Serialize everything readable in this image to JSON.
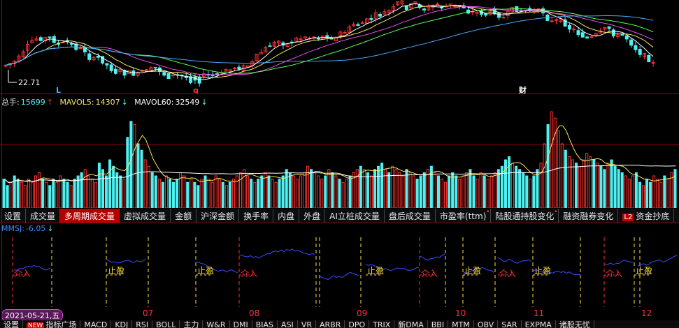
{
  "kline": {
    "low_label": "22.71",
    "markers": [
      {
        "text": "L",
        "color": "#3fa9ff"
      },
      {
        "text": "q",
        "color": "#ff3333"
      },
      {
        "text": "财",
        "color": "#ffffff"
      }
    ]
  },
  "volume_legend": {
    "total_label": "总手:",
    "total_value": "15699",
    "total_arrow": "↑",
    "mavol5_label": "MAVOL5:",
    "mavol5_value": "14307",
    "mavol5_arrow": "↓",
    "mavol60_label": "MAVOL60:",
    "mavol60_value": "32549",
    "mavol60_arrow": "↓"
  },
  "tabs": [
    {
      "label": "设置"
    },
    {
      "label": "成交量"
    },
    {
      "label": "多周期成交量",
      "active": true
    },
    {
      "label": "虚拟成交量"
    },
    {
      "label": "金额"
    },
    {
      "label": "沪深金额"
    },
    {
      "label": "换手率"
    },
    {
      "label": "内盘"
    },
    {
      "label": "外盘"
    },
    {
      "label": "AI立桩成交量"
    },
    {
      "label": "盘后成交量"
    },
    {
      "label": "市盈率(ttm)",
      "dot": "•"
    },
    {
      "label": "陆股通持股变化",
      "dot": "•"
    },
    {
      "label": "融资融券变化"
    },
    {
      "label": "资金抄底",
      "badge": "L2"
    }
  ],
  "indicator": {
    "label": "MMSJ:",
    "value": "-6.05",
    "arrow": "↓",
    "buy_text": "介入",
    "sell_text": "止盈"
  },
  "xaxis": {
    "date_box": "2021-05-21,五",
    "months": [
      "07",
      "08",
      "09",
      "10",
      "11",
      "12"
    ]
  },
  "bottom_tabs": [
    {
      "label": "设置"
    },
    {
      "label": "指标广场",
      "new": "NEW"
    },
    {
      "label": "MACD"
    },
    {
      "label": "KDJ"
    },
    {
      "label": "RSI"
    },
    {
      "label": "BOLL"
    },
    {
      "label": "主力"
    },
    {
      "label": "W&R"
    },
    {
      "label": "DMI"
    },
    {
      "label": "BIAS"
    },
    {
      "label": "ASI"
    },
    {
      "label": "VR"
    },
    {
      "label": "ARBR"
    },
    {
      "label": "DPO"
    },
    {
      "label": "TRIX"
    },
    {
      "label": "新DMA"
    },
    {
      "label": "BBI"
    },
    {
      "label": "MTM"
    },
    {
      "label": "OBV"
    },
    {
      "label": "SAR"
    },
    {
      "label": "EXPMA"
    },
    {
      "label": "诸股无忧"
    }
  ],
  "colors": {
    "up": "#ff3232",
    "down": "#4ef0f0",
    "grid": "#8b0a0a",
    "ma5": "#ffffff",
    "ma10": "#f5e663",
    "ma20": "#e653e6",
    "ma30": "#5cff5c",
    "ma60": "#4aa8ff",
    "vol_ma5": "#f5e663",
    "vol_ma60": "#ffffff",
    "mmsj_line": "#3a4cff",
    "signal_line": "#ffe23a"
  },
  "chart_data": {
    "type": "bar",
    "title": "",
    "volume": {
      "name": "总手",
      "values": [
        9,
        7,
        8,
        10,
        9,
        8,
        7,
        9,
        8,
        10,
        11,
        9,
        8,
        7,
        9,
        8,
        10,
        9,
        8,
        7,
        9,
        10,
        11,
        12,
        10,
        9,
        8,
        14,
        12,
        10,
        15,
        13,
        11,
        10,
        9,
        22,
        27,
        26,
        20,
        18,
        15,
        13,
        11,
        10,
        9,
        8,
        10,
        9,
        8,
        9,
        11,
        10,
        8,
        9,
        8,
        7,
        9,
        10,
        9,
        8,
        10,
        9,
        8,
        7,
        8,
        9,
        10,
        11,
        12,
        10,
        9,
        8,
        9,
        10,
        11,
        10,
        9,
        8,
        9,
        10,
        12,
        11,
        10,
        9,
        10,
        11,
        13,
        12,
        11,
        10,
        9,
        10,
        12,
        11,
        10,
        9,
        8,
        9,
        10,
        11,
        12,
        13,
        12,
        11,
        10,
        12,
        13,
        14,
        12,
        11,
        13,
        12,
        11,
        10,
        12,
        11,
        10,
        9,
        10,
        11,
        12,
        13,
        11,
        10,
        9,
        8,
        10,
        11,
        10,
        9,
        10,
        11,
        12,
        10,
        9,
        11,
        10,
        9,
        10,
        11,
        12,
        13,
        15,
        16,
        14,
        13,
        12,
        11,
        10,
        9,
        10,
        12,
        14,
        20,
        26,
        30,
        28,
        24,
        20,
        18,
        16,
        15,
        14,
        13,
        15,
        17,
        16,
        15,
        14,
        13,
        12,
        14,
        15,
        13,
        12,
        11,
        10,
        9,
        10,
        11,
        8,
        7,
        9,
        8,
        10,
        9,
        8,
        10,
        9,
        11,
        12
      ]
    }
  }
}
